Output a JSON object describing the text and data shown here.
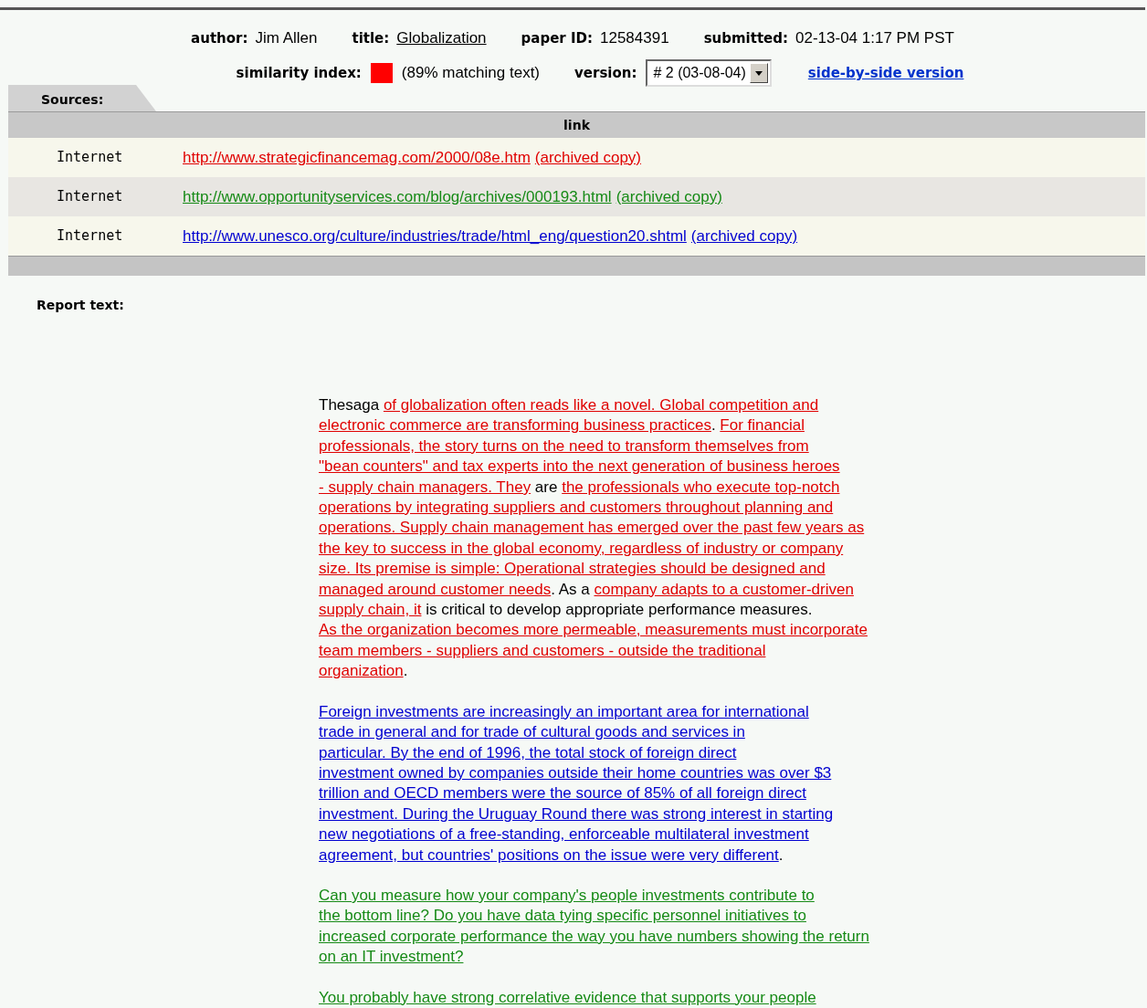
{
  "meta": {
    "author_label": "author:",
    "author": "Jim Allen",
    "title_label": "title:",
    "title": "Globalization",
    "paper_id_label": "paper ID:",
    "paper_id": "12584391",
    "submitted_label": "submitted:",
    "submitted": "02-13-04 1:17 PM PST"
  },
  "similarity": {
    "label": "similarity index:",
    "color": "#ff0000",
    "text": "(89% matching text)"
  },
  "version": {
    "label": "version:",
    "value": "# 2 (03-08-04)"
  },
  "side_by_side": "side-by-side version",
  "sources_tab": "Sources:",
  "sources_header": "link",
  "sources": [
    {
      "type": "Internet",
      "url": "http://www.strategicfinancemag.com/2000/08e.htm",
      "archive": "(archived copy)",
      "color": "#e00000"
    },
    {
      "type": "Internet",
      "url": "http://www.opportunityservices.com/blog/archives/000193.html",
      "archive": "(archived copy)",
      "color": "#168a16"
    },
    {
      "type": "Internet",
      "url": "http://www.unesco.org/culture/industries/trade/html_eng/question20.shtml",
      "archive": "(archived copy)",
      "color": "#0000d0"
    }
  ],
  "report_label": "Report text:",
  "paragraphs": [
    [
      [
        {
          "text": "Thesaga "
        },
        {
          "text": "of globalization often reads like a novel. Global competition and",
          "color": "#e00000"
        }
      ],
      [
        {
          "text": "electronic commerce are transforming business practices",
          "color": "#e00000"
        },
        {
          "text": ". "
        },
        {
          "text": "For financial",
          "color": "#e00000"
        }
      ],
      [
        {
          "text": "professionals, the story turns on the need to transform themselves from",
          "color": "#e00000"
        }
      ],
      [
        {
          "text": "\"bean counters\" and tax experts into the next generation of business heroes",
          "color": "#e00000"
        }
      ],
      [
        {
          "text": "- supply chain managers. They",
          "color": "#e00000"
        },
        {
          "text": " are "
        },
        {
          "text": "the professionals who execute top-notch",
          "color": "#e00000"
        }
      ],
      [
        {
          "text": "operations by integrating suppliers and customers throughout planning and",
          "color": "#e00000"
        }
      ],
      [
        {
          "text": "operations. Supply chain management has emerged over the past few years as",
          "color": "#e00000"
        }
      ],
      [
        {
          "text": "the key to success in the global economy, regardless of industry or company",
          "color": "#e00000"
        }
      ],
      [
        {
          "text": "size. Its premise is simple: Operational strategies should be designed and",
          "color": "#e00000"
        }
      ],
      [
        {
          "text": "managed around customer needs",
          "color": "#e00000"
        },
        {
          "text": ". As a "
        },
        {
          "text": "company adapts to a customer-driven",
          "color": "#e00000"
        }
      ],
      [
        {
          "text": "supply chain, it",
          "color": "#e00000"
        },
        {
          "text": " is critical to develop appropriate performance measures."
        }
      ],
      [
        {
          "text": "As the organization becomes more permeable, measurements must incorporate",
          "color": "#e00000"
        }
      ],
      [
        {
          "text": "team members - suppliers and customers - outside the traditional",
          "color": "#e00000"
        }
      ],
      [
        {
          "text": "organization",
          "color": "#e00000"
        },
        {
          "text": "."
        }
      ]
    ],
    [
      [
        {
          "text": "Foreign investments are increasingly an important area for international",
          "color": "#0000d0"
        }
      ],
      [
        {
          "text": "trade in general and for trade of cultural goods and services in",
          "color": "#0000d0"
        }
      ],
      [
        {
          "text": "particular. By the end of 1996, the total stock of foreign direct",
          "color": "#0000d0"
        }
      ],
      [
        {
          "text": "investment owned by companies outside their home countries was over $3",
          "color": "#0000d0"
        }
      ],
      [
        {
          "text": "trillion and OECD members were the source of 85% of all foreign direct",
          "color": "#0000d0"
        }
      ],
      [
        {
          "text": "investment. During the Uruguay Round there was strong interest in starting",
          "color": "#0000d0"
        }
      ],
      [
        {
          "text": "new negotiations of a free-standing, enforceable multilateral investment",
          "color": "#0000d0"
        }
      ],
      [
        {
          "text": "agreement, but countries' positions on the issue were very different",
          "color": "#0000d0"
        },
        {
          "text": "."
        }
      ]
    ],
    [
      [
        {
          "text": "Can you measure how your company's people investments contribute to",
          "color": "#168a16"
        }
      ],
      [
        {
          "text": "the bottom line? Do you have data tying specific personnel initiatives to",
          "color": "#168a16"
        }
      ],
      [
        {
          "text": "increased corporate performance the way you have numbers showing the return",
          "color": "#168a16"
        }
      ],
      [
        {
          "text": "on an IT investment?",
          "color": "#168a16"
        }
      ]
    ],
    [
      [
        {
          "text": "You probably have strong correlative evidence that supports your people",
          "color": "#168a16"
        }
      ]
    ]
  ]
}
